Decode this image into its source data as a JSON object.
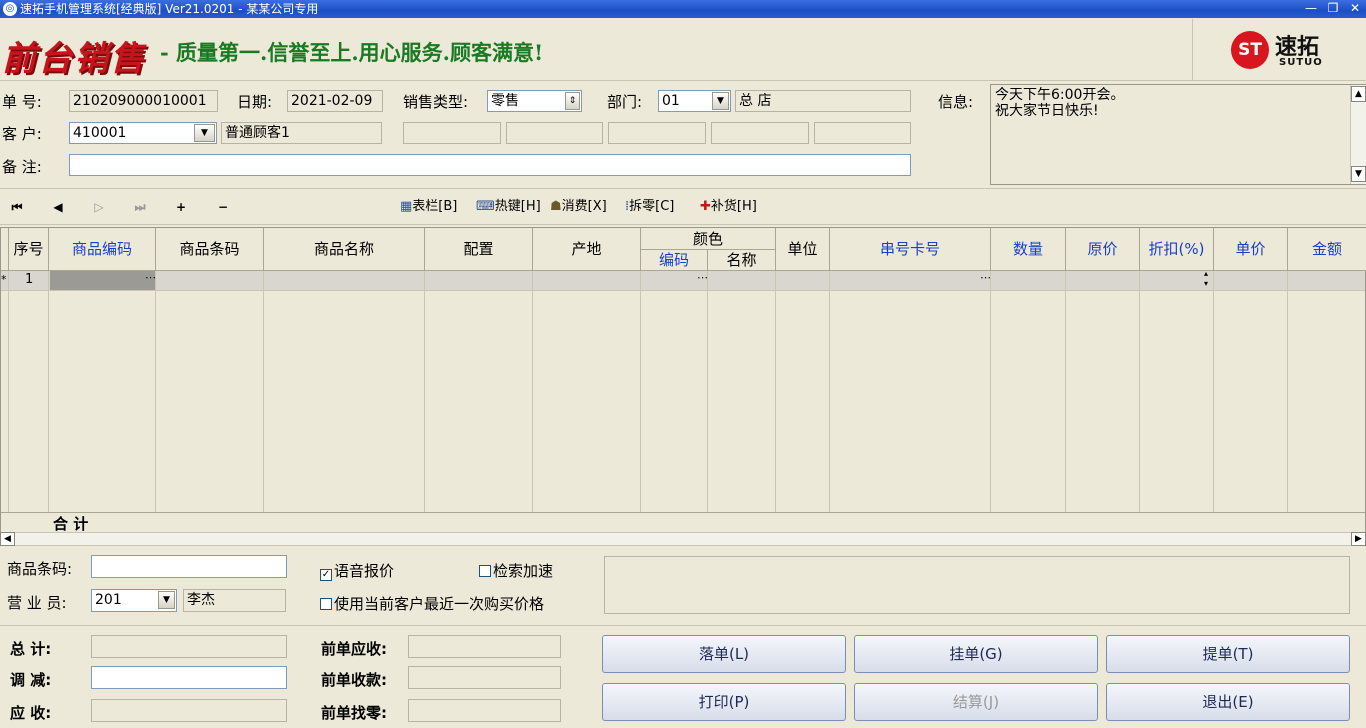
{
  "window": {
    "title": "速拓手机管理系统[经典版] Ver21.0201 - 某某公司专用",
    "minimize": "—",
    "restore": "❐",
    "close": "✕"
  },
  "banner": {
    "logo_text": "前台销售",
    "slogan": "- 质量第一.信誉至上.用心服务.顾客满意!",
    "brand_mark": "ST",
    "brand_cn": "速拓",
    "brand_en": "SUTUO"
  },
  "header": {
    "order_no_label": "单  号:",
    "order_no": "210209000010001",
    "date_label": "日期:",
    "date": "2021-02-09",
    "sale_type_label": "销售类型:",
    "sale_type": "零售",
    "dept_label": "部门:",
    "dept_code": "01",
    "dept_name": "总  店",
    "info_label": "信息:",
    "customer_label": "客  户:",
    "customer_code": "410001",
    "customer_name": "普通顾客1",
    "remark_label": "备  注:",
    "remark": "",
    "info_lines": [
      "今天下午6:00开会。",
      "祝大家节日快乐!"
    ]
  },
  "toolbar": {
    "nav": [
      "⏮",
      "◀",
      "▷",
      "⏭",
      "+",
      "−"
    ],
    "buttons": [
      {
        "label": "表栏[B]",
        "icon": "table-icon"
      },
      {
        "label": "热键[H]",
        "icon": "keyboard-icon"
      },
      {
        "label": "消费[X]",
        "icon": "consume-icon"
      },
      {
        "label": "拆零[C]",
        "icon": "split-icon"
      },
      {
        "label": "补货[H]",
        "icon": "restock-icon"
      }
    ]
  },
  "grid": {
    "columns": [
      "序号",
      "商品编码",
      "商品条码",
      "商品名称",
      "配置",
      "产地",
      "编码",
      "名称",
      "单位",
      "串号卡号",
      "数量",
      "原价",
      "折扣(%)",
      "单价",
      "金额"
    ],
    "color_group": "颜色",
    "rows": [
      {
        "marker": "*",
        "no": "1"
      }
    ],
    "total_label": "合  计"
  },
  "bottom": {
    "barcode_label": "商品条码:",
    "barcode": "",
    "voice_label": "语音报价",
    "voice_checked": true,
    "search_speed_label": "检索加速",
    "search_speed_checked": false,
    "sales_label": "营 业 员:",
    "sales_code": "201",
    "sales_name": "李杰",
    "last_price_label": "使用当前客户最近一次购买价格",
    "last_price_checked": false
  },
  "summary": {
    "total_label": "总    计:",
    "total": "",
    "adjust_label": "调    减:",
    "adjust": "",
    "receivable_label": "应    收:",
    "receivable": "",
    "prev_receivable_label": "前单应收:",
    "prev_receivable": "",
    "prev_received_label": "前单收款:",
    "prev_received": "",
    "prev_change_label": "前单找零:",
    "prev_change": ""
  },
  "actions": {
    "place_order": "落单(L)",
    "hold_order": "挂单(G)",
    "retrieve_order": "提单(T)",
    "print": "打印(P)",
    "checkout": "结算(J)",
    "exit": "退出(E)"
  }
}
